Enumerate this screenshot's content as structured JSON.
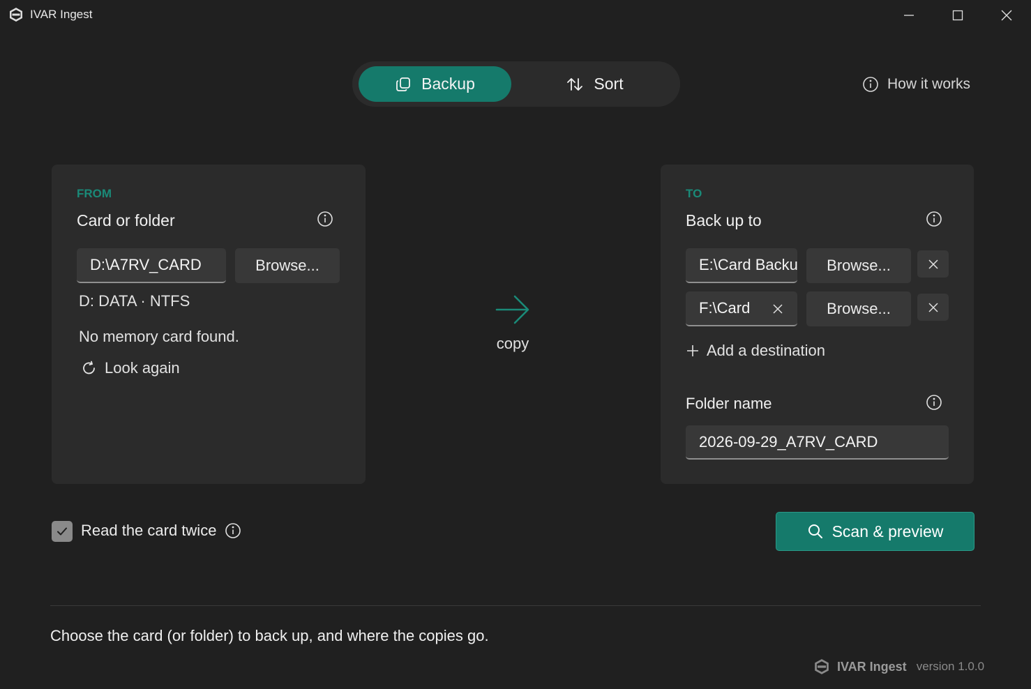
{
  "window": {
    "title": "IVAR Ingest",
    "controls": [
      "minimize-icon",
      "maximize-icon",
      "close-icon"
    ]
  },
  "mode_switch": {
    "tabs": [
      {
        "label": "Backup",
        "icon": "copy-icon",
        "selected": true
      },
      {
        "label": "Sort",
        "icon": "sort-arrows-icon",
        "selected": false
      }
    ]
  },
  "help_link": {
    "label": "How it works",
    "icon": "info-icon"
  },
  "from_panel": {
    "eyebrow": "FROM",
    "title": "Card or folder",
    "path_value": "D:\\A7RV_CARD",
    "browse_label": "Browse...",
    "drive_info": "D: DATA · NTFS",
    "status": "No memory card found.",
    "look_again_label": "Look again"
  },
  "center": {
    "label": "copy",
    "icon": "arrow-right-icon"
  },
  "to_panel": {
    "eyebrow": "TO",
    "title": "Back up to",
    "destinations": [
      {
        "value": "E:\\Card Backups",
        "browse_label": "Browse..."
      },
      {
        "value": "F:\\Card",
        "browse_label": "Browse..."
      }
    ],
    "add_label": "Add a destination",
    "folder_name_label": "Folder name",
    "folder_name_value": "2026-09-29_A7RV_CARD"
  },
  "read_twice": {
    "label": "Read the card twice",
    "checked": true
  },
  "scan_button": {
    "label": "Scan & preview",
    "icon": "search-icon"
  },
  "status_text": "Choose the card (or folder) to back up, and where the copies go.",
  "footer": {
    "app_name": "IVAR Ingest",
    "version": "version 1.0.0"
  },
  "colors": {
    "accent": "#157a6b",
    "eyebrow": "#1a8a78",
    "background": "#202020",
    "panel": "#2b2b2b"
  }
}
